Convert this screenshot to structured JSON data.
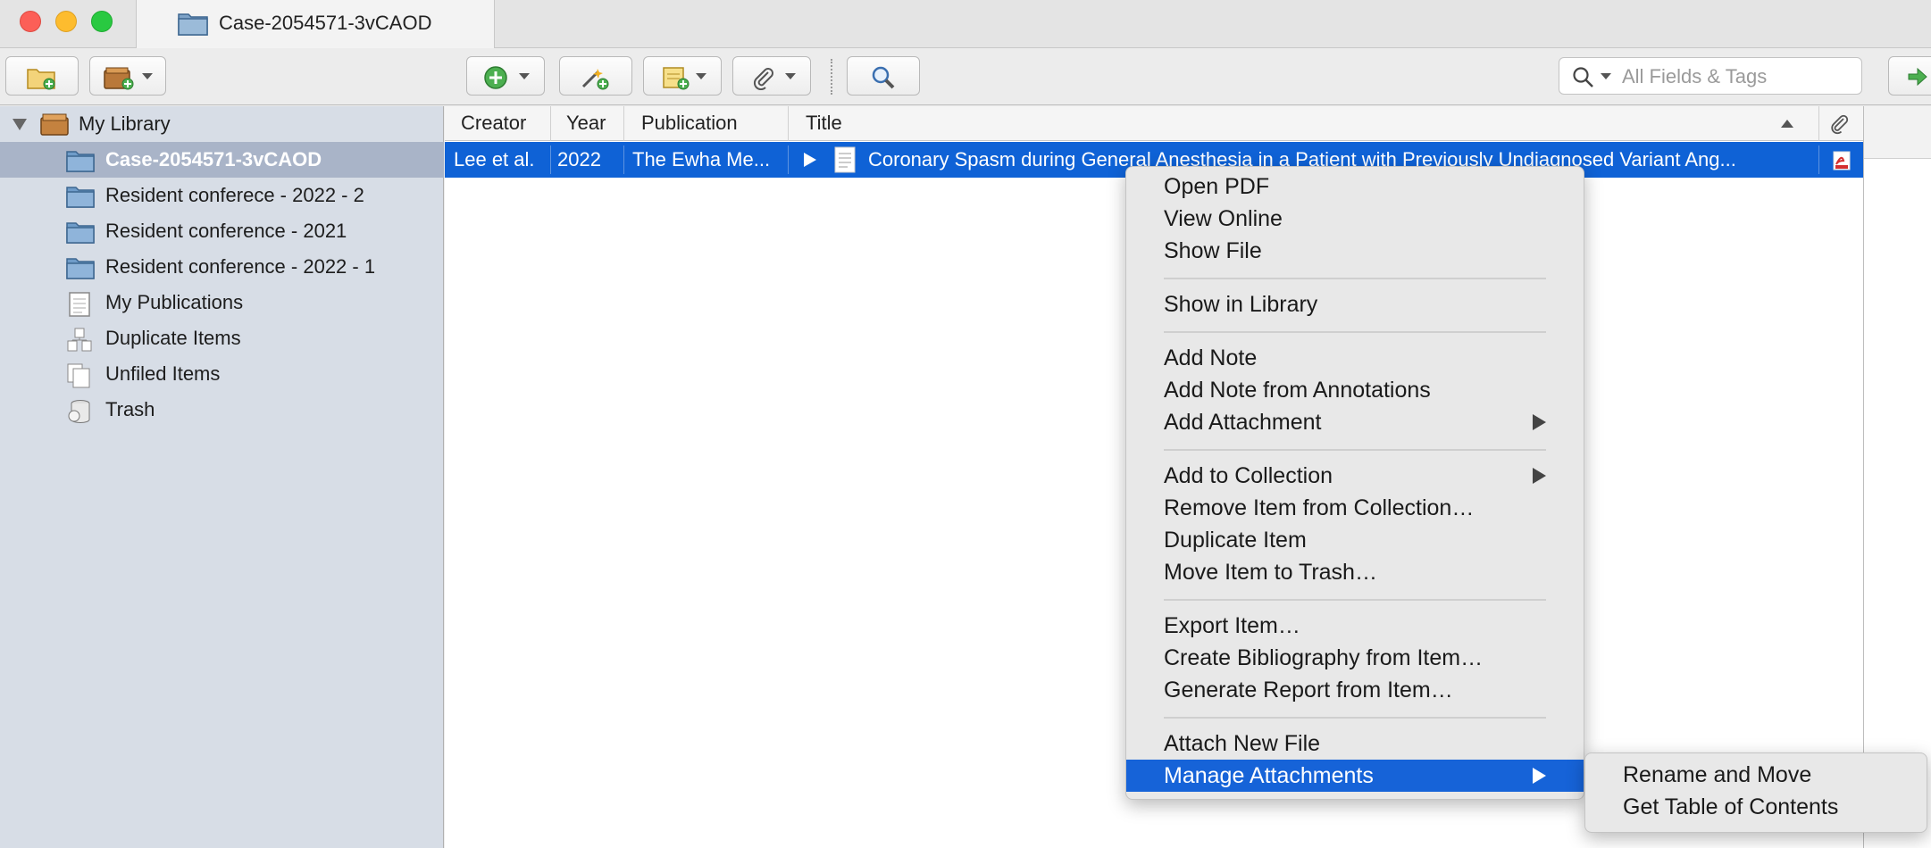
{
  "window": {
    "tab_title": "Case-2054571-3vCAOD"
  },
  "toolbar": {
    "new_collection_icon": "new-collection-icon",
    "new_library_icon": "new-library-icon",
    "new_item_icon": "new-item-icon",
    "add_by_identifier_icon": "magic-wand-icon",
    "new_note_icon": "new-note-icon",
    "add_attachment_icon": "paperclip-icon",
    "advanced_search_icon": "magnifier-icon",
    "search": {
      "placeholder": "All Fields & Tags"
    }
  },
  "sidebar": {
    "library_label": "My Library",
    "items": [
      {
        "label": "Case-2054571-3vCAOD",
        "icon": "folder-icon",
        "selected": true
      },
      {
        "label": "Resident conferece - 2022 - 2",
        "icon": "folder-icon"
      },
      {
        "label": "Resident conference - 2021",
        "icon": "folder-icon"
      },
      {
        "label": "Resident conference - 2022 - 1",
        "icon": "folder-icon"
      },
      {
        "label": "My Publications",
        "icon": "publications-icon"
      },
      {
        "label": "Duplicate Items",
        "icon": "duplicate-icon"
      },
      {
        "label": "Unfiled Items",
        "icon": "unfiled-icon"
      },
      {
        "label": "Trash",
        "icon": "trash-icon"
      }
    ]
  },
  "items_table": {
    "columns": [
      "Creator",
      "Year",
      "Publication",
      "Title"
    ],
    "rows": [
      {
        "creator": "Lee et al.",
        "year": "2022",
        "publication": "The Ewha Me...",
        "title": "Coronary Spasm during General Anesthesia in a Patient with Previously Undiagnosed Variant Ang..."
      }
    ]
  },
  "context_menu": {
    "groups": [
      [
        "Open PDF",
        "View Online",
        "Show File"
      ],
      [
        "Show in Library"
      ],
      [
        "Add Note",
        "Add Note from Annotations",
        "Add Attachment"
      ],
      [
        "Add to Collection",
        "Remove Item from Collection…",
        "Duplicate Item",
        "Move Item to Trash…"
      ],
      [
        "Export Item…",
        "Create Bibliography from Item…",
        "Generate Report from Item…"
      ],
      [
        "Attach New File",
        "Manage Attachments"
      ]
    ],
    "highlighted": "Manage Attachments"
  },
  "submenu": {
    "items": [
      "Rename and Move",
      "Get Table of Contents"
    ]
  },
  "colors": {
    "selection_blue": "#0f62d6",
    "menu_highlight": "#1663d8",
    "sidebar_bg": "#d7dde6"
  }
}
